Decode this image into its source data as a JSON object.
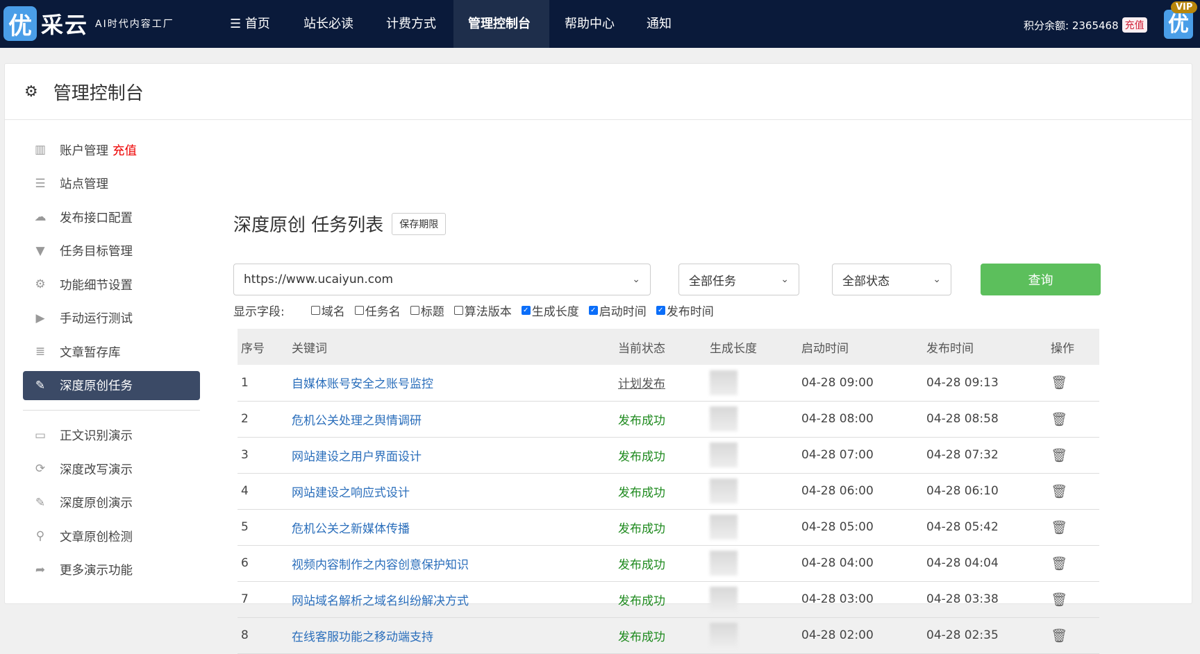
{
  "brand": {
    "logo_char": "优",
    "name": "采云",
    "slogan": "AI时代内容工厂"
  },
  "nav": {
    "items": [
      {
        "label": "☰ 首页"
      },
      {
        "label": "站长必读"
      },
      {
        "label": "计费方式"
      },
      {
        "label": "管理控制台",
        "active": true
      },
      {
        "label": "帮助中心"
      },
      {
        "label": "通知"
      }
    ],
    "balance_label": "积分余额: 2365468",
    "recharge": "充值",
    "vip_char": "优",
    "vip_tag": "VIP"
  },
  "colors": {
    "nav_bg": "#0a1a3a",
    "accent_green": "#5cbf5c",
    "link": "#2a6ebb",
    "success": "#1e8a1e",
    "sidebar_active": "#3b4a66"
  },
  "panel": {
    "title": "管理控制台"
  },
  "sidebar": {
    "items": [
      {
        "label": "账户管理",
        "badge": "充值",
        "icon": "bar-chart-icon"
      },
      {
        "label": "站点管理",
        "icon": "server-icon"
      },
      {
        "label": "发布接口配置",
        "icon": "cloud-upload-icon"
      },
      {
        "label": "任务目标管理",
        "icon": "filter-icon"
      },
      {
        "label": "功能细节设置",
        "icon": "gears-icon"
      },
      {
        "label": "手动运行测试",
        "icon": "play-icon"
      },
      {
        "label": "文章暂存库",
        "icon": "database-icon"
      },
      {
        "label": "深度原创任务",
        "icon": "edit-icon",
        "active": true
      }
    ],
    "demo_items": [
      {
        "label": "正文识别演示",
        "icon": "monitor-icon"
      },
      {
        "label": "深度改写演示",
        "icon": "refresh-icon"
      },
      {
        "label": "深度原创演示",
        "icon": "edit-icon"
      },
      {
        "label": "文章原创检测",
        "icon": "search-icon"
      },
      {
        "label": "更多演示功能",
        "icon": "share-icon"
      }
    ]
  },
  "main": {
    "title": "深度原创 任务列表",
    "retention_button": "保存期限",
    "site_select": "https://www.ucaiyun.com",
    "task_select": "全部任务",
    "status_select": "全部状态",
    "query_button": "查询",
    "fields_label": "显示字段:",
    "fields": [
      {
        "label": "域名",
        "checked": false
      },
      {
        "label": "任务名",
        "checked": false
      },
      {
        "label": "标题",
        "checked": false
      },
      {
        "label": "算法版本",
        "checked": false
      },
      {
        "label": "生成长度",
        "checked": true
      },
      {
        "label": "启动时间",
        "checked": true
      },
      {
        "label": "发布时间",
        "checked": true
      }
    ],
    "columns": [
      "序号",
      "关键词",
      "当前状态",
      "生成长度",
      "启动时间",
      "发布时间",
      "操作"
    ],
    "rows": [
      {
        "no": "1",
        "keyword": "自媒体账号安全之账号监控",
        "status": "计划发布",
        "start": "04-28 09:00",
        "publish": "04-28 09:13"
      },
      {
        "no": "2",
        "keyword": "危机公关处理之舆情调研",
        "status": "发布成功",
        "start": "04-28 08:00",
        "publish": "04-28 08:58"
      },
      {
        "no": "3",
        "keyword": "网站建设之用户界面设计",
        "status": "发布成功",
        "start": "04-28 07:00",
        "publish": "04-28 07:32"
      },
      {
        "no": "4",
        "keyword": "网站建设之响应式设计",
        "status": "发布成功",
        "start": "04-28 06:00",
        "publish": "04-28 06:10"
      },
      {
        "no": "5",
        "keyword": "危机公关之新媒体传播",
        "status": "发布成功",
        "start": "04-28 05:00",
        "publish": "04-28 05:42"
      },
      {
        "no": "6",
        "keyword": "视频内容制作之内容创意保护知识",
        "status": "发布成功",
        "start": "04-28 04:00",
        "publish": "04-28 04:04"
      },
      {
        "no": "7",
        "keyword": "网站域名解析之域名纠纷解决方式",
        "status": "发布成功",
        "start": "04-28 03:00",
        "publish": "04-28 03:38"
      },
      {
        "no": "8",
        "keyword": "在线客服功能之移动端支持",
        "status": "发布成功",
        "start": "04-28 02:00",
        "publish": "04-28 02:35"
      }
    ]
  }
}
